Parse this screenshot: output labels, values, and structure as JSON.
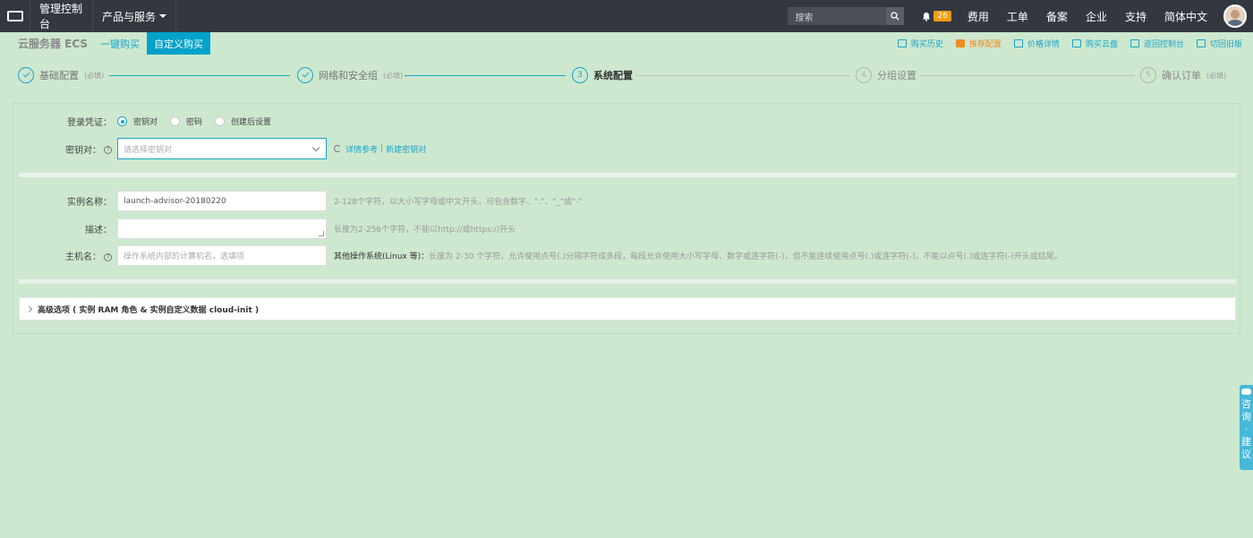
{
  "topbar": {
    "console": "管理控制台",
    "products": "产品与服务",
    "search_placeholder": "搜索",
    "notifications": "26",
    "links": [
      "费用",
      "工单",
      "备案",
      "企业",
      "支持",
      "简体中文"
    ]
  },
  "subhead": {
    "product": "云服务器 ECS",
    "tabs": [
      "一键购买",
      "自定义购买"
    ],
    "quick_links": [
      "购买历史",
      "推荐配置",
      "价格详情",
      "购买云盘",
      "返回控制台",
      "切回旧版"
    ]
  },
  "steps": [
    {
      "label": "基础配置",
      "required": "(必填)",
      "state": "done",
      "num": ""
    },
    {
      "label": "网络和安全组",
      "required": "(必填)",
      "state": "done",
      "num": ""
    },
    {
      "label": "系统配置",
      "required": "",
      "state": "current",
      "num": "3"
    },
    {
      "label": "分组设置",
      "required": "",
      "state": "todo",
      "num": "4"
    },
    {
      "label": "确认订单",
      "required": "(必填)",
      "state": "todo",
      "num": "5"
    }
  ],
  "form": {
    "login_label": "登录凭证",
    "login_options": [
      "密钥对",
      "密码",
      "创建后设置"
    ],
    "keypair_label": "密钥对",
    "keypair_placeholder": "请选择密钥对",
    "keypair_links": [
      "详情参考",
      "新建密钥对"
    ],
    "instance_name_label": "实例名称",
    "instance_name_value": "launch-advisor-20180220",
    "instance_name_hint": "2-128个字符，以大小写字母或中文开头，可包含数字、\".\"、\"_\"或\"-\"",
    "desc_label": "描述",
    "desc_hint": "长度为2-256个字符，不能以http://或https://开头",
    "hostname_label": "主机名",
    "hostname_placeholder": "操作系统内部的计算机名，选填项",
    "hostname_hint_bold": "其他操作系统(Linux 等)：",
    "hostname_hint": "长度为 2-30 个字符，允许使用点号(.)分隔字符成多段，每段允许使用大小写字母、数字或连字符(-)，但不能连续使用点号(.)或连字符(-)。不能以点号(.)或连字符(-)开头或结尾。",
    "advanced": "高级选项 ( 实例 RAM 角色 & 实例自定义数据 cloud-init )"
  },
  "consult": [
    "咨",
    "询",
    "·",
    "建",
    "议"
  ]
}
